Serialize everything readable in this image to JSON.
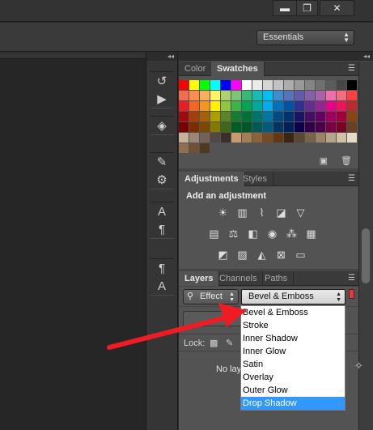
{
  "window": {
    "minimize_glyph": "▬",
    "restore_glyph": "❐",
    "close_glyph": "✕"
  },
  "workspace": {
    "value": "Essentials"
  },
  "collapse": {
    "glyph": "◂◂"
  },
  "tool_groups": [
    {
      "tools": [
        {
          "name": "history-icon",
          "glyph": "↺"
        },
        {
          "name": "play-action-icon",
          "glyph": "▶"
        }
      ]
    },
    {
      "tools": [
        {
          "name": "3d-icon",
          "glyph": "◈"
        }
      ]
    },
    {
      "tools": [
        {
          "name": "brush-icon",
          "glyph": "✎"
        },
        {
          "name": "brush-presets-icon",
          "glyph": "⚙"
        }
      ]
    },
    {
      "tools": [
        {
          "name": "character-icon",
          "glyph": "A"
        },
        {
          "name": "paragraph-icon",
          "glyph": "¶"
        }
      ]
    },
    {
      "tools": [
        {
          "name": "paragraph-styles-icon",
          "glyph": "¶"
        },
        {
          "name": "character-styles-icon",
          "glyph": "A"
        }
      ]
    }
  ],
  "color_panel": {
    "tabs": [
      "Color",
      "Swatches"
    ],
    "active_tab": "Swatches",
    "menu_glyph": "☰",
    "swatch_colors": [
      "#ff0000",
      "#ffff00",
      "#00ff00",
      "#00ffff",
      "#0000ff",
      "#ff00ff",
      "#ffffff",
      "#ebebeb",
      "#d6d6d6",
      "#c2c2c2",
      "#adadad",
      "#999999",
      "#858585",
      "#707070",
      "#5c5c5c",
      "#474747",
      "#000000",
      "#f26c4f",
      "#f68e55",
      "#fbaf5c",
      "#fff467",
      "#acd372",
      "#7cc576",
      "#3bb878",
      "#1abbb4",
      "#00bff3",
      "#438ccb",
      "#5574b9",
      "#605ca8",
      "#855fa8",
      "#a763a8",
      "#f06ea9",
      "#f26d7d",
      "#ff4040",
      "#ed1c24",
      "#f26522",
      "#f7941d",
      "#fff200",
      "#8dc63f",
      "#39b54a",
      "#00a651",
      "#00a99d",
      "#00aeef",
      "#0072bc",
      "#0054a6",
      "#2e3192",
      "#662d91",
      "#92278f",
      "#ec008c",
      "#ed145b",
      "#c1272d",
      "#9e0b0f",
      "#a0410d",
      "#a3620a",
      "#aba000",
      "#598527",
      "#1a7b30",
      "#007236",
      "#00746b",
      "#0076a3",
      "#004b80",
      "#003471",
      "#1b1464",
      "#440e62",
      "#630460",
      "#9e005d",
      "#9e0039",
      "#8b4513",
      "#790000",
      "#7b2e00",
      "#7d4900",
      "#827b00",
      "#406618",
      "#005e20",
      "#005826",
      "#005952",
      "#005b7f",
      "#003663",
      "#002157",
      "#0d004c",
      "#32004b",
      "#4b0049",
      "#7b0046",
      "#7a0026",
      "#6b3f1f",
      "#c7b299",
      "#998675",
      "#736357",
      "#534741",
      "#37302d",
      "#c69c6d",
      "#a67c52",
      "#8c6239",
      "#754c24",
      "#603913",
      "#3c2415",
      "#5a4632",
      "#7a6449",
      "#9a8466",
      "#b5a488",
      "#cfc2a6",
      "#e6dcc5",
      "#8f6f4f",
      "#6e5233",
      "#4d3a21"
    ],
    "new_icon": "▣",
    "delete_icon": "🗑"
  },
  "adjustments_panel": {
    "tabs": [
      "Adjustments",
      "Styles"
    ],
    "active_tab": "Adjustments",
    "menu_glyph": "☰",
    "title": "Add an adjustment",
    "rows": [
      [
        {
          "name": "brightness-contrast-icon",
          "glyph": "☀"
        },
        {
          "name": "levels-icon",
          "glyph": "▥"
        },
        {
          "name": "curves-icon",
          "glyph": "⌇"
        },
        {
          "name": "exposure-icon",
          "glyph": "◪"
        },
        {
          "name": "vibrance-icon",
          "glyph": "▽"
        }
      ],
      [
        {
          "name": "hue-saturation-icon",
          "glyph": "▤"
        },
        {
          "name": "color-balance-icon",
          "glyph": "⚖"
        },
        {
          "name": "black-white-icon",
          "glyph": "◧"
        },
        {
          "name": "photo-filter-icon",
          "glyph": "◉"
        },
        {
          "name": "channel-mixer-icon",
          "glyph": "⁂"
        },
        {
          "name": "color-lookup-icon",
          "glyph": "▦"
        }
      ],
      [
        {
          "name": "invert-icon",
          "glyph": "◩"
        },
        {
          "name": "posterize-icon",
          "glyph": "▨"
        },
        {
          "name": "threshold-icon",
          "glyph": "◭"
        },
        {
          "name": "selective-color-icon",
          "glyph": "⊠"
        },
        {
          "name": "gradient-map-icon",
          "glyph": "▭"
        }
      ]
    ]
  },
  "layers_panel": {
    "tabs": [
      "Layers",
      "Channels",
      "Paths"
    ],
    "active_tab": "Layers",
    "menu_glyph": "☰",
    "filter_type": "Effect",
    "filter_value": "Bevel & Emboss",
    "lock_label": "Lock:",
    "empty_text": "No lay"
  },
  "effect_dropdown": {
    "options": [
      "Bevel & Emboss",
      "Stroke",
      "Inner Shadow",
      "Inner Glow",
      "Satin",
      "Overlay",
      "Outer Glow",
      "Drop Shadow"
    ],
    "highlighted": "Drop Shadow"
  },
  "annotation": {
    "arrow_color": "#ee1c24"
  }
}
